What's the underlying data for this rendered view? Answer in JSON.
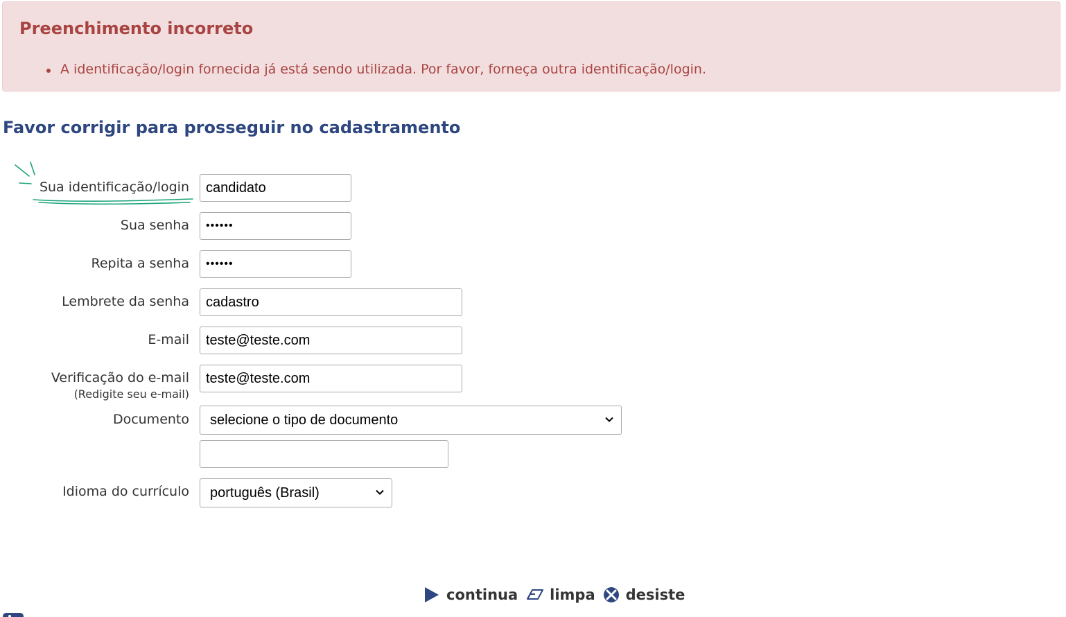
{
  "alert": {
    "title": "Preenchimento incorreto",
    "messages": [
      "A identificação/login fornecida já está sendo utilizada. Por favor, forneça outra identificação/login."
    ]
  },
  "heading": "Favor corrigir para prosseguir no cadastramento",
  "form": {
    "login": {
      "label": "Sua identificação/login",
      "value": "candidato"
    },
    "password": {
      "label": "Sua senha",
      "value": "••••••"
    },
    "password_repeat": {
      "label": "Repita a senha",
      "value": "••••••"
    },
    "password_hint": {
      "label": "Lembrete da senha",
      "value": "cadastro"
    },
    "email": {
      "label": "E-mail",
      "value": "teste@teste.com"
    },
    "email_verify": {
      "label": "Verificação do e-mail",
      "sublabel": "(Redigite seu e-mail)",
      "value": "teste@teste.com"
    },
    "document": {
      "label": "Documento",
      "selected": "selecione o tipo de documento",
      "number_value": ""
    },
    "cv_language": {
      "label": "Idioma do currículo",
      "selected": "português (Brasil)"
    }
  },
  "actions": {
    "continue": "continua",
    "clear": "limpa",
    "cancel": "desiste"
  },
  "colors": {
    "alert_bg": "#f2dede",
    "alert_text": "#a94442",
    "heading": "#2e4780",
    "icon": "#2e4780",
    "annotation": "#1aa37a"
  }
}
